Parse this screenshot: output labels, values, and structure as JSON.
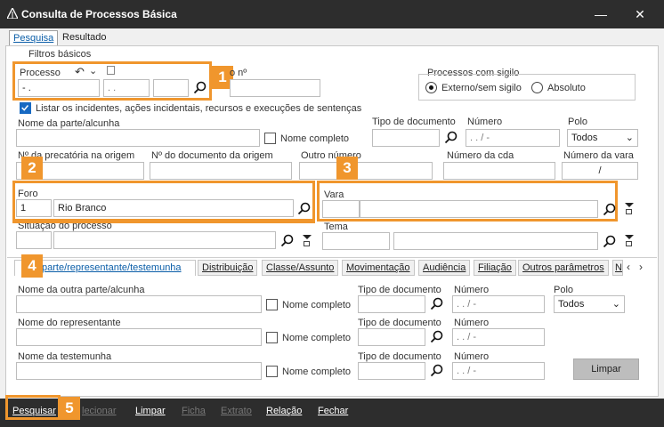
{
  "window": {
    "title": "Consulta de Processos Básica"
  },
  "tabs": [
    "Pesquisa",
    "Resultado"
  ],
  "basic_filters": {
    "group_label": "Filtros básicos",
    "processo_label": "Processo",
    "processo_seg1": "-  .",
    "processo_seg2": ".  .",
    "partial_label": "o nº",
    "sigilo": {
      "group_label": "Processos com sigilo",
      "option1": "Externo/sem sigilo",
      "option2": "Absoluto"
    },
    "incidentes_label": "Listar os incidentes, ações incidentais, recursos e execuções de sentenças"
  },
  "party": {
    "nome_label": "Nome da parte/alcunha",
    "nome_completo": "Nome completo",
    "tipo_doc_label": "Tipo de documento",
    "numero_label": "Número",
    "numero_mask": ". .  /   -",
    "polo_label": "Polo",
    "polo_value": "Todos"
  },
  "row3": {
    "precatoria": "Nº da precatória na origem",
    "doc_origem": "Nº do documento da origem",
    "outro_numero": "Outro número",
    "numero_cda": "Número da cda",
    "numero_vara": "Número da vara",
    "numero_vara_value": "/"
  },
  "foro": {
    "label": "Foro",
    "code": "1",
    "name": "Rio Branco"
  },
  "vara": {
    "label": "Vara"
  },
  "situacao": {
    "label": "Situação do processo"
  },
  "tema": {
    "label": "Tema"
  },
  "subtabs": [
    "Outra parte/representante/testemunha",
    "Distribuição",
    "Classe/Assunto",
    "Movimentação",
    "Audiência",
    "Filiação",
    "Outros parâmetros",
    "N"
  ],
  "subtab_first_visible": "parte/representante/testemunha",
  "lower": {
    "outra_parte_label": "Nome da outra parte/alcunha",
    "representante_label": "Nome do representante",
    "testemunha_label": "Nome da testemunha",
    "nome_completo": "Nome completo",
    "tipo_doc_label": "Tipo de documento",
    "numero_label": "Número",
    "numero_mask": ". .  /   -",
    "polo_label": "Polo",
    "polo_value": "Todos",
    "limpar": "Limpar"
  },
  "badges": [
    "1",
    "2",
    "3",
    "4",
    "5"
  ],
  "bottom": {
    "pesquisar": "Pesquisar",
    "selecionar": "lecionar",
    "limpar": "Limpar",
    "ficha": "Ficha",
    "extrato": "Extrato",
    "relacao": "Relação",
    "fechar": "Fechar"
  },
  "colors": {
    "accent_orange": "#f0962d",
    "link_blue": "#0b5ea8",
    "dark": "#2d2d2d"
  }
}
